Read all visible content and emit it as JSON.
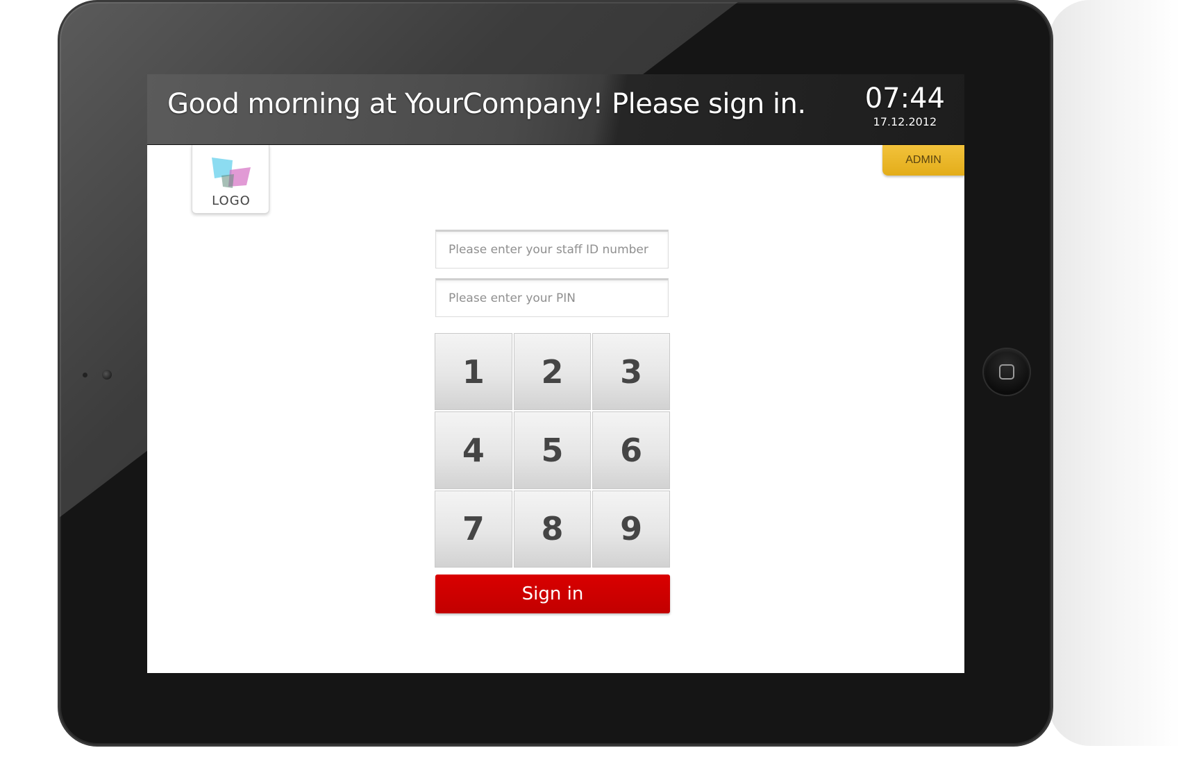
{
  "header": {
    "greeting": "Good morning at YourCompany! Please sign in.",
    "time": "07:44",
    "date": "17.12.2012"
  },
  "admin": {
    "label": "ADMIN"
  },
  "logo": {
    "text": "LOGO"
  },
  "form": {
    "staff_id_placeholder": "Please enter your staff ID number",
    "pin_placeholder": "Please enter your PIN",
    "sign_in_label": "Sign in"
  },
  "keypad": {
    "keys": [
      "1",
      "2",
      "3",
      "4",
      "5",
      "6",
      "7",
      "8",
      "9"
    ]
  },
  "colors": {
    "accent": "#c80000",
    "admin_tab": "#eab52a",
    "header_bg": "#2a2a2a"
  },
  "icons": {
    "home_button": "home-square-icon",
    "camera": "camera-icon"
  }
}
